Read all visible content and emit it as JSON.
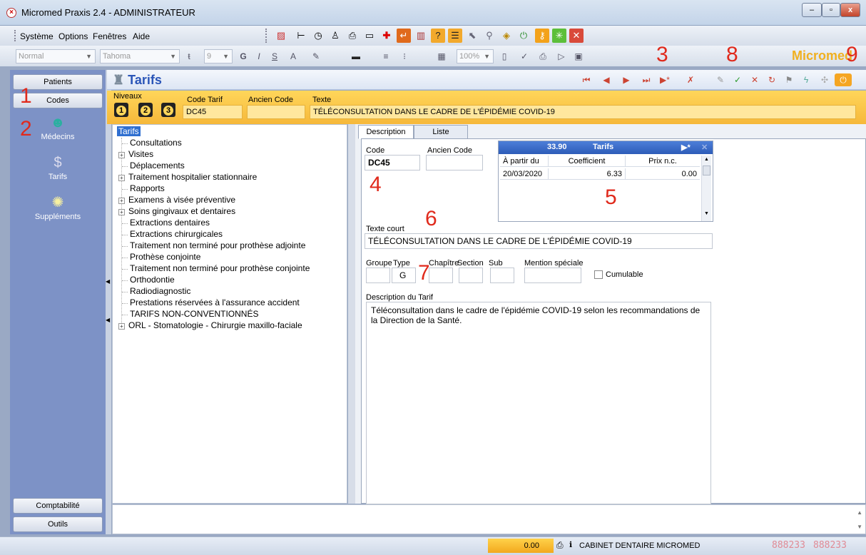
{
  "window": {
    "title": "Micromed Praxis 2.4 - ADMINISTRATEUR",
    "min": "–",
    "max": "▫",
    "close": "x"
  },
  "menu": {
    "items": [
      "Système",
      "Options",
      "Fenêtres",
      "Aide"
    ]
  },
  "format_bar": {
    "style": "Normal",
    "font": "Tahoma",
    "size": "9",
    "zoom": "100%",
    "bold": "G",
    "italic": "I",
    "underline": "S"
  },
  "brand": "Micromed",
  "left_nav": {
    "patients": "Patients",
    "codes": "Codes",
    "items": [
      {
        "label": "Médecins",
        "icon": "doctor-icon"
      },
      {
        "label": "Tarifs",
        "icon": "money-bag-icon"
      },
      {
        "label": "Suppléments",
        "icon": "supplement-icon"
      }
    ],
    "comptabilite": "Comptabilité",
    "outils": "Outils"
  },
  "header": {
    "title": "Tarifs"
  },
  "strip": {
    "niveaux_label": "Niveaux",
    "levels": [
      "1",
      "2",
      "3"
    ],
    "code_tarif_label": "Code Tarif",
    "code_tarif": "DC45",
    "ancien_code_label": "Ancien Code",
    "ancien_code": "",
    "texte_label": "Texte",
    "texte": "TÉLÉCONSULTATION DANS LE CADRE DE L'ÉPIDÉMIE COVID-19"
  },
  "tree": {
    "root": "Tarifs",
    "items": [
      {
        "label": "Consultations",
        "expandable": false
      },
      {
        "label": "Visites",
        "expandable": true
      },
      {
        "label": "Déplacements",
        "expandable": false
      },
      {
        "label": "Traitement hospitalier stationnaire",
        "expandable": true
      },
      {
        "label": "Rapports",
        "expandable": false
      },
      {
        "label": "Examens à visée préventive",
        "expandable": true
      },
      {
        "label": "Soins gingivaux et dentaires",
        "expandable": true
      },
      {
        "label": "Extractions dentaires",
        "expandable": false
      },
      {
        "label": "Extractions chirurgicales",
        "expandable": false
      },
      {
        "label": "Traitement non terminé pour prothèse adjointe",
        "expandable": false
      },
      {
        "label": "Prothèse conjointe",
        "expandable": false
      },
      {
        "label": "Traitement non terminé pour prothèse conjointe",
        "expandable": false
      },
      {
        "label": "Orthodontie",
        "expandable": false
      },
      {
        "label": "Radiodiagnostic",
        "expandable": false
      },
      {
        "label": "Prestations réservées à l'assurance accident",
        "expandable": false
      },
      {
        "label": "TARIFS NON-CONVENTIONNÉS",
        "expandable": false
      },
      {
        "label": "ORL - Stomatologie - Chirurgie maxillo-faciale",
        "expandable": true
      }
    ]
  },
  "tabs": [
    "Description",
    "Liste"
  ],
  "desc": {
    "code_label": "Code",
    "code": "DC45",
    "ancien_code_label": "Ancien Code",
    "ancien_code": "",
    "texte_court_label": "Texte court",
    "texte_court": "TÉLÉCONSULTATION DANS LE CADRE DE L'ÉPIDÉMIE COVID-19",
    "groupe_label": "Groupe",
    "type_label": "Type",
    "type": "G",
    "chapitre_label": "Chapître",
    "section_label": "Section",
    "sub_label": "Sub",
    "mention_label": "Mention spéciale",
    "cumulable_label": "Cumulable",
    "description_label": "Description du Tarif",
    "description": "Téléconsultation dans le cadre de l'épidémie COVID-19 selon les recommandations de la Direction de la Santé."
  },
  "mini_grid": {
    "value": "33.90",
    "title": "Tarifs",
    "columns": [
      "À partir du",
      "Coefficient",
      "Prix n.c."
    ],
    "rows": [
      [
        "20/03/2020",
        "6.33",
        "0.00"
      ]
    ]
  },
  "annotations": [
    "1",
    "2",
    "3",
    "4",
    "5",
    "6",
    "7",
    "8",
    "9"
  ],
  "status": {
    "amount": "0.00",
    "cabinet": "CABINET DENTAIRE MICROMED",
    "led1": "888233",
    "led2": "888233"
  },
  "colors": {
    "accent": "#f6b83a",
    "title_blue": "#2b56b8",
    "annotation_red": "#e02a1c",
    "nav_blue": "#7d92c6"
  }
}
